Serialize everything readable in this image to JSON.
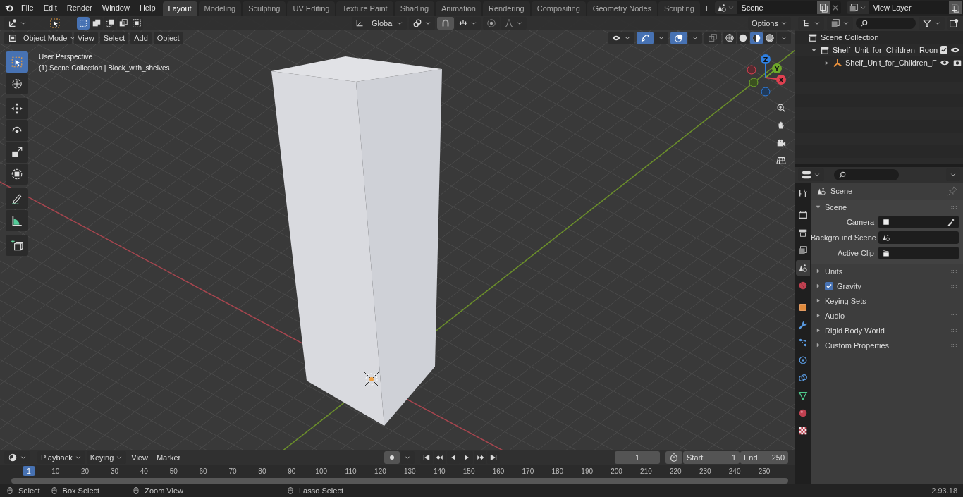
{
  "menu": [
    "File",
    "Edit",
    "Render",
    "Window",
    "Help"
  ],
  "workspaces": [
    {
      "label": "Layout",
      "selected": true
    },
    {
      "label": "Modeling",
      "selected": false
    },
    {
      "label": "Sculpting",
      "selected": false
    },
    {
      "label": "UV Editing",
      "selected": false
    },
    {
      "label": "Texture Paint",
      "selected": false
    },
    {
      "label": "Shading",
      "selected": false
    },
    {
      "label": "Animation",
      "selected": false
    },
    {
      "label": "Rendering",
      "selected": false
    },
    {
      "label": "Compositing",
      "selected": false
    },
    {
      "label": "Geometry Nodes",
      "selected": false
    },
    {
      "label": "Scripting",
      "selected": false
    }
  ],
  "add_workspace": "+",
  "scene": {
    "name": "Scene"
  },
  "view_layer": {
    "name": "View Layer"
  },
  "viewport": {
    "select_modes": [
      {
        "kind": "set",
        "selected": true
      },
      {
        "kind": "extend",
        "selected": false
      },
      {
        "kind": "subtract",
        "selected": false
      },
      {
        "kind": "difference",
        "selected": false
      },
      {
        "kind": "intersect",
        "selected": false
      }
    ],
    "orientation": "Global",
    "options": "Options",
    "mode": "Object Mode",
    "menus": [
      "View",
      "Select",
      "Add",
      "Object"
    ],
    "toggles": [
      {
        "kind": "gizmos",
        "on": true
      },
      {
        "kind": "overlays",
        "on": true
      },
      {
        "kind": "xray",
        "on": false
      }
    ],
    "shading": [
      {
        "kind": "wireframe",
        "selected": false
      },
      {
        "kind": "solid",
        "selected": false
      },
      {
        "kind": "material",
        "selected": true
      },
      {
        "kind": "rendered",
        "selected": false
      }
    ],
    "overlay_text": [
      "User Perspective",
      "(1) Scene Collection | Block_with_shelves"
    ],
    "tools": [
      {
        "kind": "select",
        "selected": true
      },
      {
        "kind": "cursor",
        "selected": false
      },
      {
        "kind": "move",
        "selected": false
      },
      {
        "kind": "rotate",
        "selected": false
      },
      {
        "kind": "scale",
        "selected": false
      },
      {
        "kind": "transform",
        "selected": false
      },
      {
        "kind": "annotate",
        "selected": false
      },
      {
        "kind": "measure",
        "selected": false
      },
      {
        "kind": "add_cube",
        "selected": false
      }
    ],
    "axes": [
      {
        "label": "Z"
      },
      {
        "label": "Y"
      },
      {
        "label": "X"
      }
    ]
  },
  "outliner": {
    "root": "Scene Collection",
    "items": [
      {
        "label": "Shelf_Unit_for_Children_Roon",
        "expanded": true,
        "checked": true,
        "children": [
          {
            "label": "Shelf_Unit_for_Children_F",
            "expanded": false
          }
        ]
      }
    ]
  },
  "properties": {
    "tabs": [
      {
        "kind": "tool",
        "selected": false
      },
      {
        "kind": "render",
        "selected": false
      },
      {
        "kind": "output",
        "selected": false
      },
      {
        "kind": "view_layer",
        "selected": false
      },
      {
        "kind": "scene",
        "selected": true
      },
      {
        "kind": "world",
        "selected": false
      },
      {
        "kind": "object",
        "selected": false
      },
      {
        "kind": "modifiers",
        "selected": false
      },
      {
        "kind": "particles",
        "selected": false
      },
      {
        "kind": "physics",
        "selected": false
      },
      {
        "kind": "constraints",
        "selected": false
      },
      {
        "kind": "data",
        "selected": false
      },
      {
        "kind": "material",
        "selected": false
      },
      {
        "kind": "texture",
        "selected": false
      }
    ],
    "context": "Scene",
    "panel": {
      "title": "Scene",
      "expanded": true,
      "fields": [
        {
          "label": "Camera",
          "kind": "camera"
        },
        {
          "label": "Background Scene",
          "kind": "scene"
        },
        {
          "label": "Active Clip",
          "kind": "clip"
        }
      ]
    },
    "sections": [
      {
        "label": "Units",
        "kind": "plain",
        "expanded": false
      },
      {
        "label": "Gravity",
        "kind": "checkbox",
        "checked": true,
        "expanded": false
      },
      {
        "label": "Keying Sets",
        "kind": "plain",
        "expanded": false
      },
      {
        "label": "Audio",
        "kind": "plain",
        "expanded": false
      },
      {
        "label": "Rigid Body World",
        "kind": "plain",
        "expanded": false
      },
      {
        "label": "Custom Properties",
        "kind": "plain",
        "expanded": false
      }
    ]
  },
  "timeline": {
    "menus": [
      {
        "label": "Playback",
        "dropdown": true
      },
      {
        "label": "Keying",
        "dropdown": true
      },
      {
        "label": "View",
        "dropdown": false
      },
      {
        "label": "Marker",
        "dropdown": false
      }
    ],
    "current_frame": "1",
    "start_label": "Start",
    "start": "1",
    "end_label": "End",
    "end": "250",
    "current_marker": "1",
    "ticks": [
      "10",
      "20",
      "30",
      "40",
      "50",
      "60",
      "70",
      "80",
      "90",
      "100",
      "110",
      "120",
      "130",
      "140",
      "150",
      "160",
      "170",
      "180",
      "190",
      "200",
      "210",
      "220",
      "230",
      "240",
      "250"
    ]
  },
  "status": {
    "hints": [
      "Select",
      "Box Select",
      "Zoom View",
      "Lasso Select"
    ],
    "version": "2.93.18"
  }
}
